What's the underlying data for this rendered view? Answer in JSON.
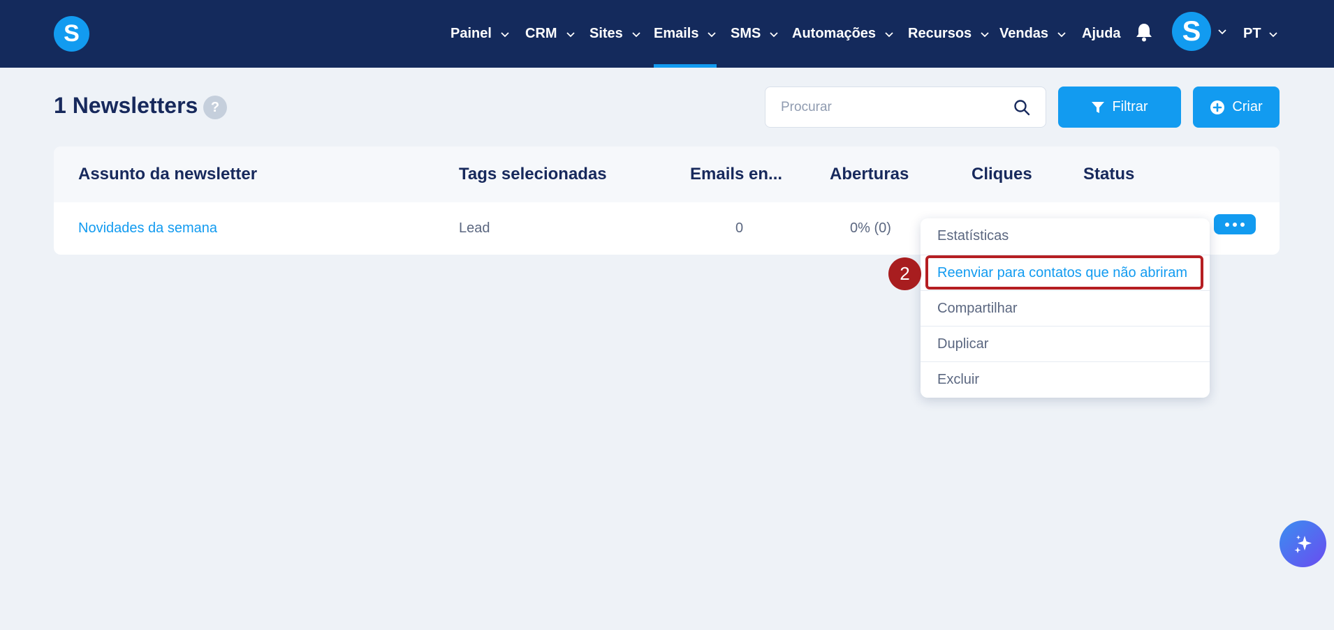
{
  "brand": {
    "logo_letter": "S"
  },
  "nav": {
    "items": [
      {
        "label": "Painel"
      },
      {
        "label": "CRM"
      },
      {
        "label": "Sites"
      },
      {
        "label": "Emails"
      },
      {
        "label": "SMS"
      },
      {
        "label": "Automações"
      },
      {
        "label": "Recursos"
      },
      {
        "label": "Vendas"
      },
      {
        "label": "Ajuda"
      }
    ],
    "active": "Emails",
    "avatar_letter": "S",
    "language": "PT"
  },
  "page": {
    "count": "1",
    "title": "Newsletters",
    "help": "?"
  },
  "search": {
    "placeholder": "Procurar",
    "value": ""
  },
  "actions": {
    "filter_label": "Filtrar",
    "create_label": "Criar"
  },
  "table": {
    "headers": [
      "Assunto da newsletter",
      "Tags selecionadas",
      "Emails en...",
      "Aberturas",
      "Cliques",
      "Status"
    ],
    "rows": [
      {
        "subject": "Novidades da semana",
        "tags": "Lead",
        "emails": "0",
        "opens": "0% (0)"
      }
    ]
  },
  "menu": {
    "items": [
      {
        "label": "Estatísticas"
      },
      {
        "label": "Reenviar para contatos que não abriram"
      },
      {
        "label": "Compartilhar"
      },
      {
        "label": "Duplicar"
      },
      {
        "label": "Excluir"
      }
    ],
    "highlighted_index": 1
  },
  "annotation": {
    "step": "2",
    "color": "#b51e22"
  },
  "colors": {
    "navy": "#142a5c",
    "accent": "#129bf0",
    "background": "#eef2f7"
  }
}
